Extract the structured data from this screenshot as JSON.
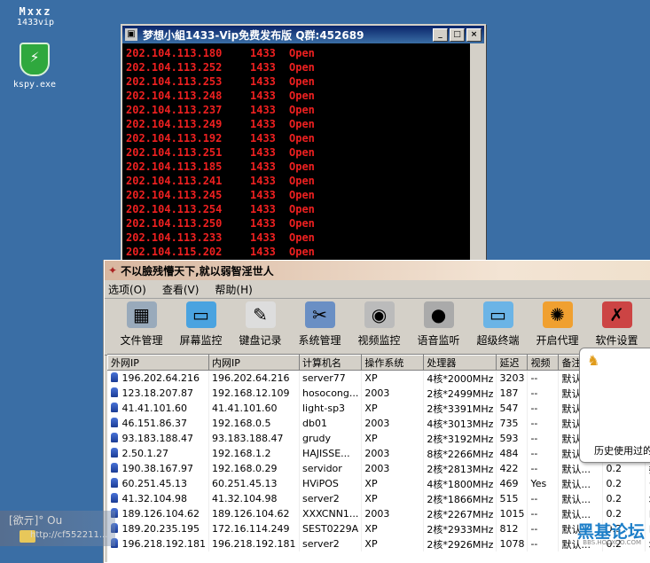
{
  "desktop": {
    "top_label": "Mxxz",
    "top_sub": "1433vip",
    "kspy_label": "kspy.exe"
  },
  "console": {
    "title": "梦想小組1433-Vip免费发布版 Q群:452689",
    "rows": [
      {
        "ip": "202.104.113.180",
        "port": "1433",
        "status": "Open"
      },
      {
        "ip": "202.104.113.252",
        "port": "1433",
        "status": "Open"
      },
      {
        "ip": "202.104.113.253",
        "port": "1433",
        "status": "Open"
      },
      {
        "ip": "202.104.113.248",
        "port": "1433",
        "status": "Open"
      },
      {
        "ip": "202.104.113.237",
        "port": "1433",
        "status": "Open"
      },
      {
        "ip": "202.104.113.249",
        "port": "1433",
        "status": "Open"
      },
      {
        "ip": "202.104.113.192",
        "port": "1433",
        "status": "Open"
      },
      {
        "ip": "202.104.113.251",
        "port": "1433",
        "status": "Open"
      },
      {
        "ip": "202.104.113.185",
        "port": "1433",
        "status": "Open"
      },
      {
        "ip": "202.104.113.241",
        "port": "1433",
        "status": "Open"
      },
      {
        "ip": "202.104.113.245",
        "port": "1433",
        "status": "Open"
      },
      {
        "ip": "202.104.113.254",
        "port": "1433",
        "status": "Open"
      },
      {
        "ip": "202.104.113.250",
        "port": "1433",
        "status": "Open"
      },
      {
        "ip": "202.104.113.233",
        "port": "1433",
        "status": "Open"
      },
      {
        "ip": "202.104.115.202",
        "port": "1433",
        "status": "Open"
      }
    ]
  },
  "app": {
    "title": "不以臉残懵天下,就以弱智淫世人",
    "menu": [
      "选项(O)",
      "查看(V)",
      "帮助(H)"
    ],
    "toolbar": [
      {
        "label": "文件管理",
        "icon": "file-manager-icon"
      },
      {
        "label": "屏幕监控",
        "icon": "screen-monitor-icon"
      },
      {
        "label": "键盘记录",
        "icon": "keylog-icon"
      },
      {
        "label": "系统管理",
        "icon": "system-manage-icon"
      },
      {
        "label": "视频监控",
        "icon": "camera-icon"
      },
      {
        "label": "语音监听",
        "icon": "microphone-icon"
      },
      {
        "label": "超级终端",
        "icon": "terminal-icon"
      },
      {
        "label": "开启代理",
        "icon": "proxy-icon"
      },
      {
        "label": "软件设置",
        "icon": "settings-icon"
      }
    ],
    "columns": [
      "外网IP",
      "内网IP",
      "计算机名",
      "操作系统",
      "处理器",
      "延迟",
      "视频",
      "备注"
    ],
    "rows": [
      [
        "196.202.64.216",
        "196.202.64.216",
        "server77",
        "XP",
        "4核*2000MHz",
        "3203",
        "--",
        "默认"
      ],
      [
        "123.18.207.87",
        "192.168.12.109",
        "hosocong...",
        "2003",
        "2核*2499MHz",
        "187",
        "--",
        "默认"
      ],
      [
        "41.41.101.60",
        "41.41.101.60",
        "light-sp3",
        "XP",
        "2核*3391MHz",
        "547",
        "--",
        "默认"
      ],
      [
        "46.151.86.37",
        "192.168.0.5",
        "db01",
        "2003",
        "4核*3013MHz",
        "735",
        "--",
        "默认"
      ],
      [
        "93.183.188.47",
        "93.183.188.47",
        "grudy",
        "XP",
        "2核*3192MHz",
        "593",
        "--",
        "默认"
      ],
      [
        "2.50.1.27",
        "192.168.1.2",
        "HAJISSE...",
        "2003",
        "8核*2266MHz",
        "484",
        "--",
        "默认"
      ],
      [
        "190.38.167.97",
        "192.168.0.29",
        "servidor",
        "2003",
        "2核*2813MHz",
        "422",
        "--",
        "默认..."
      ],
      [
        "60.251.45.13",
        "60.251.45.13",
        "HViPOS",
        "XP",
        "4核*1800MHz",
        "469",
        "Yes",
        "默认..."
      ],
      [
        "41.32.104.98",
        "41.32.104.98",
        "server2",
        "XP",
        "2核*1866MHz",
        "515",
        "--",
        "默认..."
      ],
      [
        "189.126.104.62",
        "189.126.104.62",
        "XXXCNN1...",
        "2003",
        "2核*2267MHz",
        "1015",
        "--",
        "默认..."
      ],
      [
        "189.20.235.195",
        "172.16.114.249",
        "SEST0229A",
        "XP",
        "2核*2933MHz",
        "812",
        "--",
        "默认..."
      ],
      [
        "196.218.192.181",
        "196.218.192.181",
        "server2",
        "XP",
        "2核*2926MHz",
        "1078",
        "--",
        "默认..."
      ]
    ],
    "extra_cols": [
      [
        "",
        ""
      ],
      [
        "",
        ""
      ],
      [
        "",
        ""
      ],
      [
        "",
        ""
      ],
      [
        "",
        ""
      ],
      [
        "",
        ""
      ],
      [
        "0.2",
        "委"
      ],
      [
        "0.2",
        "台"
      ],
      [
        "0.2",
        "埃"
      ],
      [
        "0.2",
        "巴"
      ],
      [
        "0.2",
        "巴"
      ],
      [
        "0.2",
        "埃"
      ]
    ]
  },
  "popup": {
    "text": "历史使用过的"
  },
  "taskbar": {
    "ghost_line1": "[欲亓]° Ou",
    "ghost_line2": "http://cf552211...",
    "watermark": "黑基论坛",
    "watermark_sub": "BBS.HOOXOO.COM"
  }
}
